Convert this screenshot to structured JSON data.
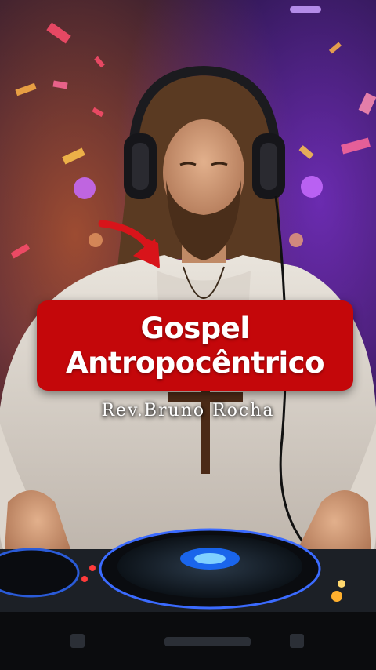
{
  "overlay": {
    "title_line1": "Gospel",
    "title_line2": "Antropocêntrico",
    "byline": "Rev.Bruno Rocha"
  },
  "colors": {
    "title_box": "#c4070a",
    "arrow": "#d8141a",
    "text": "#ffffff",
    "background_top": "#1a1030",
    "background_glow": "#8a2fd6"
  },
  "scene": {
    "subject": "dj-figure-with-headphones",
    "equipment": "dj-turntable"
  }
}
